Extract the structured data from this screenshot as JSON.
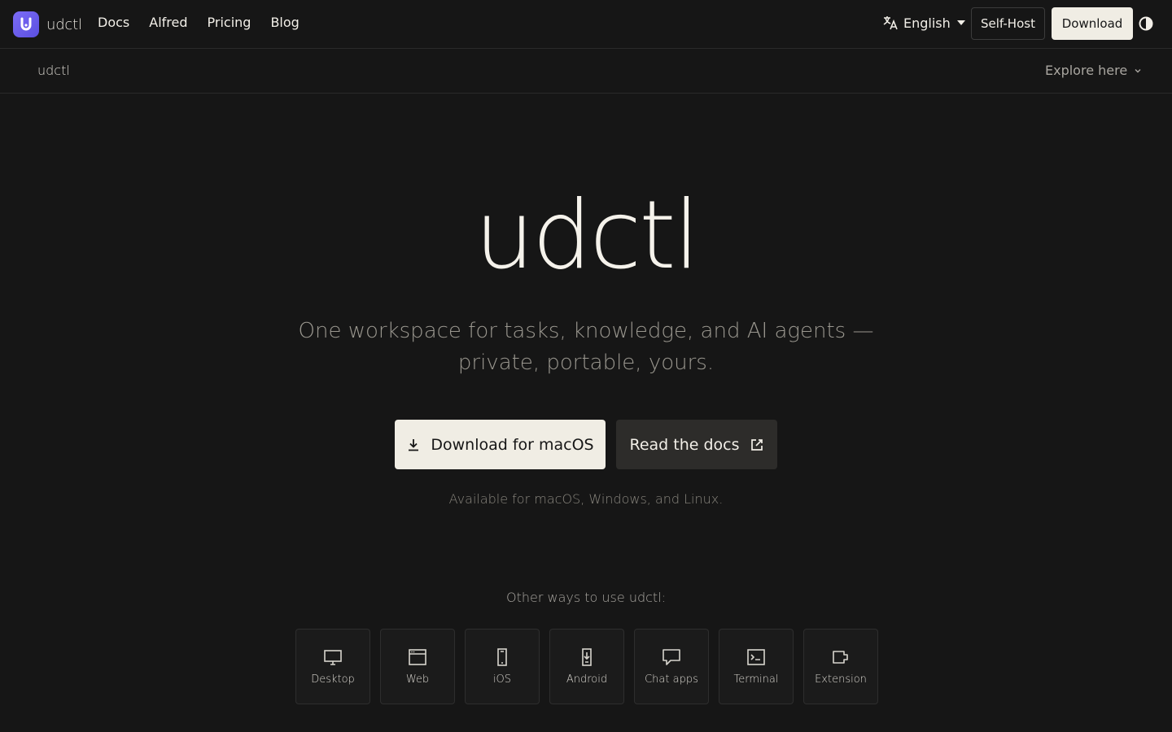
{
  "brand": {
    "name": "udctl",
    "logo_icon": "u-shape-icon",
    "accent": "#6c5ce7"
  },
  "nav": {
    "items": [
      {
        "label": "Docs"
      },
      {
        "label": "Alfred"
      },
      {
        "label": "Pricing"
      },
      {
        "label": "Blog"
      }
    ]
  },
  "header": {
    "language": "English",
    "self_host_label": "Self-Host",
    "download_label": "Download",
    "theme_icon": "contrast-icon"
  },
  "subbar": {
    "title": "udctl",
    "explore_label": "Explore here"
  },
  "hero": {
    "title": "udctl",
    "tagline": "One workspace for tasks, knowledge, and AI agents — private, portable, yours.",
    "primary_cta": "Download for macOS",
    "secondary_cta": "Read the docs",
    "availability": "Available for macOS, Windows, and Linux."
  },
  "other_ways": {
    "heading": "Other ways to use udctl:",
    "platforms": [
      {
        "label": "Desktop",
        "icon": "monitor-icon"
      },
      {
        "label": "Web",
        "icon": "browser-window-icon"
      },
      {
        "label": "iOS",
        "icon": "phone-icon"
      },
      {
        "label": "Android",
        "icon": "android-download-icon"
      },
      {
        "label": "Chat apps",
        "icon": "chat-bubble-icon"
      },
      {
        "label": "Terminal",
        "icon": "terminal-icon"
      },
      {
        "label": "Extension",
        "icon": "extension-icon"
      }
    ]
  }
}
